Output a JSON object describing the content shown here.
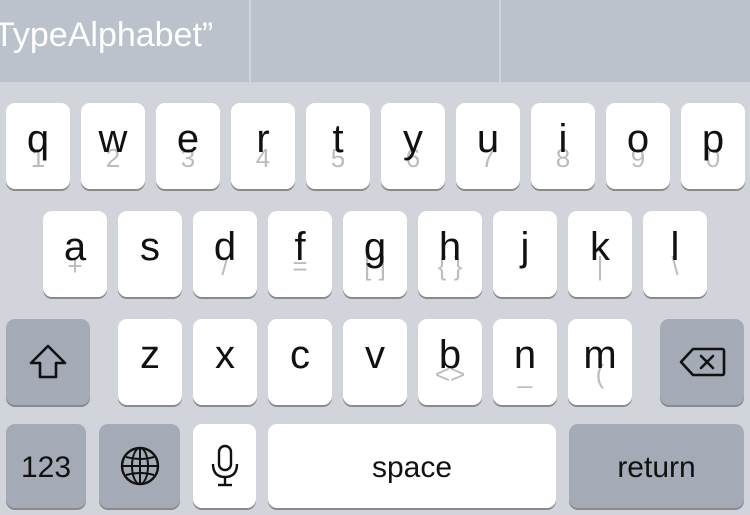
{
  "suggestions": [
    "TypeAlphabet”",
    "",
    ""
  ],
  "row1": [
    {
      "main": "q",
      "sub": "1"
    },
    {
      "main": "w",
      "sub": "2"
    },
    {
      "main": "e",
      "sub": "3"
    },
    {
      "main": "r",
      "sub": "4"
    },
    {
      "main": "t",
      "sub": "5"
    },
    {
      "main": "y",
      "sub": "6"
    },
    {
      "main": "u",
      "sub": "7"
    },
    {
      "main": "i",
      "sub": "8"
    },
    {
      "main": "o",
      "sub": "9"
    },
    {
      "main": "p",
      "sub": "0"
    }
  ],
  "row2": [
    {
      "main": "a",
      "sub": "+"
    },
    {
      "main": "s",
      "sub": ""
    },
    {
      "main": "d",
      "sub": "/"
    },
    {
      "main": "f",
      "sub": "="
    },
    {
      "main": "g",
      "sub": "[ ]"
    },
    {
      "main": "h",
      "sub": "{ }"
    },
    {
      "main": "j",
      "sub": ""
    },
    {
      "main": "k",
      "sub": "|"
    },
    {
      "main": "l",
      "sub": "\\"
    }
  ],
  "row3": [
    {
      "main": "z",
      "sub": ""
    },
    {
      "main": "x",
      "sub": ""
    },
    {
      "main": "c",
      "sub": ""
    },
    {
      "main": "v",
      "sub": ""
    },
    {
      "main": "b",
      "sub": "<>"
    },
    {
      "main": "n",
      "sub": "_"
    },
    {
      "main": "m",
      "sub": "("
    }
  ],
  "bottom": {
    "numbers_label": "123",
    "space_label": "space",
    "return_label": "return"
  },
  "icons": {
    "shift": "shift-icon",
    "delete": "delete-icon",
    "globe": "globe-icon",
    "mic": "microphone-icon"
  },
  "colors": {
    "keyboard_bg": "#d1d4da",
    "key_bg": "#ffffff",
    "function_key_bg": "#a4abb6",
    "suggestion_bar_bg": "#bcc2cb"
  }
}
